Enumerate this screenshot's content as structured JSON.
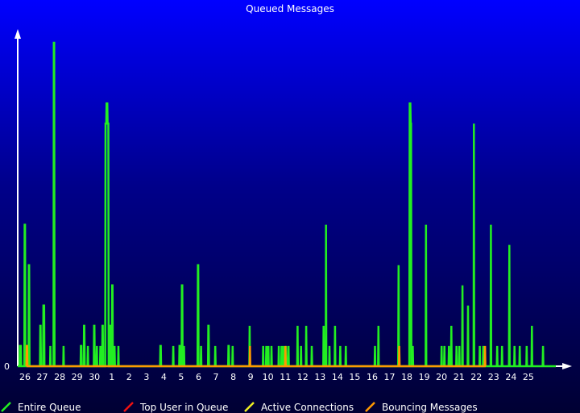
{
  "chart_data": {
    "type": "line",
    "title": "Queued Messages",
    "xlabel": "",
    "ylabel": "",
    "y_tick_labels": [
      "0"
    ],
    "ylim": [
      0,
      16
    ],
    "x_tick_labels": [
      "26",
      "27",
      "28",
      "29",
      "30",
      "1",
      "2",
      "3",
      "4",
      "5",
      "6",
      "7",
      "8",
      "9",
      "10",
      "11",
      "12",
      "13",
      "14",
      "15",
      "16",
      "17",
      "18",
      "19",
      "20",
      "21",
      "22",
      "23",
      "24",
      "25"
    ],
    "xlim": [
      0,
      31
    ],
    "grid": false,
    "legend_position": "bottom",
    "colors": {
      "Entire Queue": "#22ee22",
      "Top User in Queue": "#ee1111",
      "Active Connections": "#eeee22",
      "Bouncing Messages": "#ff9900",
      "axes": "#ffffff"
    },
    "series": [
      {
        "name": "Entire Queue",
        "points": [
          [
            0.0,
            0
          ],
          [
            0.1,
            0
          ],
          [
            0.12,
            1
          ],
          [
            0.18,
            1
          ],
          [
            0.2,
            0
          ],
          [
            0.38,
            0
          ],
          [
            0.4,
            7
          ],
          [
            0.42,
            7
          ],
          [
            0.44,
            0
          ],
          [
            0.62,
            0
          ],
          [
            0.64,
            5
          ],
          [
            0.66,
            5
          ],
          [
            0.68,
            0
          ],
          [
            1.28,
            0
          ],
          [
            1.3,
            2
          ],
          [
            1.32,
            2
          ],
          [
            1.34,
            0
          ],
          [
            1.46,
            0
          ],
          [
            1.48,
            3
          ],
          [
            1.52,
            3
          ],
          [
            1.54,
            0
          ],
          [
            1.86,
            0
          ],
          [
            1.88,
            1
          ],
          [
            1.9,
            0
          ],
          [
            2.06,
            0
          ],
          [
            2.08,
            16
          ],
          [
            2.1,
            16
          ],
          [
            2.12,
            0
          ],
          [
            2.62,
            0
          ],
          [
            2.64,
            1
          ],
          [
            2.66,
            0
          ],
          [
            3.62,
            0
          ],
          [
            3.64,
            1
          ],
          [
            3.66,
            1
          ],
          [
            3.68,
            0
          ],
          [
            3.8,
            0
          ],
          [
            3.82,
            2
          ],
          [
            3.84,
            2
          ],
          [
            3.86,
            0
          ],
          [
            4.02,
            0
          ],
          [
            4.04,
            1
          ],
          [
            4.06,
            0
          ],
          [
            4.38,
            0
          ],
          [
            4.4,
            2
          ],
          [
            4.42,
            2
          ],
          [
            4.44,
            0
          ],
          [
            4.54,
            0
          ],
          [
            4.56,
            1
          ],
          [
            4.58,
            0
          ],
          [
            4.74,
            0
          ],
          [
            4.76,
            1
          ],
          [
            4.78,
            0
          ],
          [
            4.86,
            0
          ],
          [
            4.88,
            2
          ],
          [
            4.9,
            2
          ],
          [
            4.92,
            0
          ],
          [
            5.04,
            0
          ],
          [
            5.06,
            12
          ],
          [
            5.1,
            12
          ],
          [
            5.12,
            13
          ],
          [
            5.16,
            13
          ],
          [
            5.18,
            12
          ],
          [
            5.22,
            12
          ],
          [
            5.24,
            0
          ],
          [
            5.28,
            0
          ],
          [
            5.3,
            2
          ],
          [
            5.32,
            2
          ],
          [
            5.34,
            0
          ],
          [
            5.42,
            0
          ],
          [
            5.44,
            4
          ],
          [
            5.46,
            4
          ],
          [
            5.48,
            0
          ],
          [
            5.56,
            0
          ],
          [
            5.58,
            1
          ],
          [
            5.6,
            0
          ],
          [
            5.78,
            0
          ],
          [
            5.8,
            1
          ],
          [
            5.82,
            0
          ],
          [
            8.2,
            0
          ],
          [
            8.22,
            1
          ],
          [
            8.24,
            1
          ],
          [
            8.26,
            0
          ],
          [
            8.94,
            0
          ],
          [
            8.96,
            1
          ],
          [
            8.98,
            0
          ],
          [
            9.3,
            0
          ],
          [
            9.32,
            1
          ],
          [
            9.34,
            1
          ],
          [
            9.36,
            0
          ],
          [
            9.44,
            0
          ],
          [
            9.46,
            4
          ],
          [
            9.48,
            4
          ],
          [
            9.5,
            0
          ],
          [
            9.56,
            0
          ],
          [
            9.58,
            1
          ],
          [
            9.6,
            0
          ],
          [
            10.36,
            0
          ],
          [
            10.38,
            5
          ],
          [
            10.4,
            5
          ],
          [
            10.42,
            0
          ],
          [
            10.54,
            0
          ],
          [
            10.56,
            1
          ],
          [
            10.58,
            0
          ],
          [
            10.96,
            0
          ],
          [
            10.98,
            2
          ],
          [
            11,
            2
          ],
          [
            11.02,
            0
          ],
          [
            11.36,
            0
          ],
          [
            11.38,
            1
          ],
          [
            11.4,
            0
          ],
          [
            12.12,
            0
          ],
          [
            12.14,
            1
          ],
          [
            12.16,
            1
          ],
          [
            12.18,
            0
          ],
          [
            12.36,
            0
          ],
          [
            12.38,
            1
          ],
          [
            12.4,
            0
          ],
          [
            13.34,
            0
          ],
          [
            13.36,
            2
          ],
          [
            13.38,
            0
          ],
          [
            14.12,
            0
          ],
          [
            14.14,
            1
          ],
          [
            14.16,
            0
          ],
          [
            14.3,
            0
          ],
          [
            14.32,
            1
          ],
          [
            14.34,
            0
          ],
          [
            14.42,
            0
          ],
          [
            14.44,
            1
          ],
          [
            14.46,
            0
          ],
          [
            14.6,
            0
          ],
          [
            14.62,
            1
          ],
          [
            14.64,
            0
          ],
          [
            15.02,
            0
          ],
          [
            15.04,
            1
          ],
          [
            15.06,
            0
          ],
          [
            15.18,
            0
          ],
          [
            15.2,
            1
          ],
          [
            15.22,
            0
          ],
          [
            15.28,
            0
          ],
          [
            15.3,
            1
          ],
          [
            15.32,
            0
          ],
          [
            15.44,
            0
          ],
          [
            15.46,
            1
          ],
          [
            15.48,
            0
          ],
          [
            15.58,
            0
          ],
          [
            15.6,
            1
          ],
          [
            15.62,
            0
          ],
          [
            16.1,
            0
          ],
          [
            16.12,
            2
          ],
          [
            16.14,
            0
          ],
          [
            16.3,
            0
          ],
          [
            16.32,
            1
          ],
          [
            16.34,
            0
          ],
          [
            16.6,
            0
          ],
          [
            16.62,
            2
          ],
          [
            16.64,
            0
          ],
          [
            16.92,
            0
          ],
          [
            16.94,
            1
          ],
          [
            16.96,
            0
          ],
          [
            17.6,
            0
          ],
          [
            17.62,
            2
          ],
          [
            17.64,
            0
          ],
          [
            17.74,
            0
          ],
          [
            17.76,
            7
          ],
          [
            17.78,
            0
          ],
          [
            17.94,
            0
          ],
          [
            17.96,
            1
          ],
          [
            17.98,
            0
          ],
          [
            18.26,
            0
          ],
          [
            18.28,
            2
          ],
          [
            18.3,
            0
          ],
          [
            18.56,
            0
          ],
          [
            18.58,
            1
          ],
          [
            18.6,
            0
          ],
          [
            18.88,
            0
          ],
          [
            18.9,
            1
          ],
          [
            18.92,
            0
          ],
          [
            20.56,
            0
          ],
          [
            20.58,
            1
          ],
          [
            20.6,
            0
          ],
          [
            20.76,
            0
          ],
          [
            20.78,
            2
          ],
          [
            20.8,
            0
          ],
          [
            21.92,
            0
          ],
          [
            21.94,
            5
          ],
          [
            21.96,
            0
          ],
          [
            22.56,
            0
          ],
          [
            22.58,
            13
          ],
          [
            22.62,
            13
          ],
          [
            22.64,
            12
          ],
          [
            22.66,
            12
          ],
          [
            22.68,
            0
          ],
          [
            22.74,
            0
          ],
          [
            22.76,
            1
          ],
          [
            22.78,
            0
          ],
          [
            23.5,
            0
          ],
          [
            23.52,
            7
          ],
          [
            23.54,
            0
          ],
          [
            24.4,
            0
          ],
          [
            24.42,
            1
          ],
          [
            24.44,
            0
          ],
          [
            24.56,
            0
          ],
          [
            24.58,
            1
          ],
          [
            24.6,
            0
          ],
          [
            24.82,
            0
          ],
          [
            24.84,
            1
          ],
          [
            24.86,
            0
          ],
          [
            24.96,
            0
          ],
          [
            24.98,
            2
          ],
          [
            25,
            0
          ],
          [
            25.26,
            0
          ],
          [
            25.28,
            1
          ],
          [
            25.3,
            0
          ],
          [
            25.42,
            0
          ],
          [
            25.44,
            1
          ],
          [
            25.46,
            0
          ],
          [
            25.6,
            0
          ],
          [
            25.62,
            4
          ],
          [
            25.64,
            0
          ],
          [
            25.92,
            0
          ],
          [
            25.94,
            3
          ],
          [
            25.96,
            0
          ],
          [
            26.26,
            0
          ],
          [
            26.28,
            12
          ],
          [
            26.3,
            0
          ],
          [
            26.6,
            0
          ],
          [
            26.62,
            1
          ],
          [
            26.64,
            0
          ],
          [
            26.8,
            0
          ],
          [
            26.82,
            1
          ],
          [
            26.84,
            0
          ],
          [
            27.24,
            0
          ],
          [
            27.26,
            7
          ],
          [
            27.28,
            0
          ],
          [
            27.6,
            0
          ],
          [
            27.62,
            1
          ],
          [
            27.64,
            0
          ],
          [
            27.88,
            0
          ],
          [
            27.9,
            1
          ],
          [
            27.92,
            0
          ],
          [
            28.3,
            0
          ],
          [
            28.32,
            6
          ],
          [
            28.34,
            0
          ],
          [
            28.6,
            0
          ],
          [
            28.62,
            1
          ],
          [
            28.64,
            0
          ],
          [
            28.9,
            0
          ],
          [
            28.92,
            1
          ],
          [
            28.94,
            0
          ],
          [
            29.3,
            0
          ],
          [
            29.32,
            1
          ],
          [
            29.34,
            0
          ],
          [
            29.6,
            0
          ],
          [
            29.62,
            2
          ],
          [
            29.64,
            0
          ],
          [
            30.24,
            0
          ],
          [
            30.26,
            1
          ],
          [
            30.28,
            0
          ],
          [
            31.0,
            0
          ]
        ]
      },
      {
        "name": "Top User in Queue",
        "points": []
      },
      {
        "name": "Active Connections",
        "points": []
      },
      {
        "name": "Bouncing Messages",
        "points": [
          [
            0.5,
            0
          ],
          [
            0.52,
            1
          ],
          [
            0.54,
            1
          ],
          [
            0.56,
            0
          ],
          [
            13.36,
            0
          ],
          [
            13.38,
            1
          ],
          [
            13.4,
            0
          ],
          [
            15.4,
            0
          ],
          [
            15.42,
            1
          ],
          [
            15.44,
            0
          ],
          [
            21.96,
            0
          ],
          [
            21.98,
            1
          ],
          [
            22,
            0
          ],
          [
            26.9,
            0
          ],
          [
            26.92,
            1
          ],
          [
            26.94,
            0
          ]
        ]
      }
    ]
  }
}
